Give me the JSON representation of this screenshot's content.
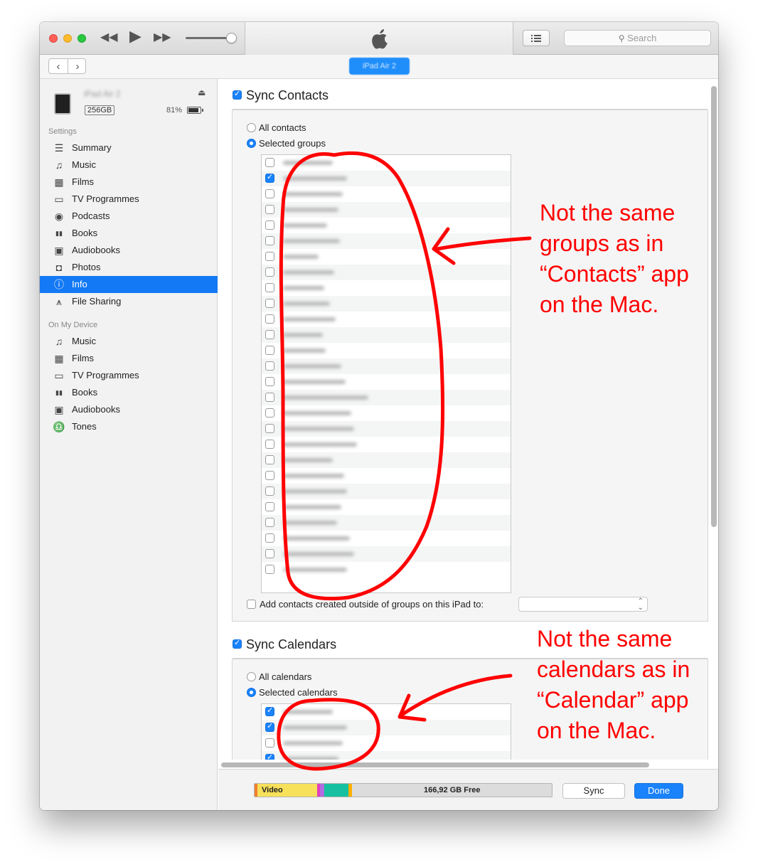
{
  "toolbar": {
    "search_placeholder": "Search",
    "icons": [
      "rewind-icon",
      "play-icon",
      "fast-forward-icon",
      "apple-logo-icon",
      "list-view-icon",
      "search-icon"
    ]
  },
  "navbar": {
    "device_name": "iPad Air 2"
  },
  "device": {
    "name": "iPad Air 2",
    "capacity": "256GB",
    "battery_percent": "81%"
  },
  "sidebar": {
    "settings_header": "Settings",
    "settings": [
      {
        "label": "Summary",
        "icon": "summary-icon"
      },
      {
        "label": "Music",
        "icon": "music-note-icon"
      },
      {
        "label": "Films",
        "icon": "film-icon"
      },
      {
        "label": "TV Programmes",
        "icon": "tv-icon"
      },
      {
        "label": "Podcasts",
        "icon": "podcast-icon"
      },
      {
        "label": "Books",
        "icon": "book-icon"
      },
      {
        "label": "Audiobooks",
        "icon": "audiobook-icon"
      },
      {
        "label": "Photos",
        "icon": "camera-icon"
      },
      {
        "label": "Info",
        "icon": "info-icon",
        "selected": true
      },
      {
        "label": "File Sharing",
        "icon": "app-store-icon"
      }
    ],
    "on_device_header": "On My Device",
    "on_device": [
      {
        "label": "Music",
        "icon": "music-note-icon"
      },
      {
        "label": "Films",
        "icon": "film-icon"
      },
      {
        "label": "TV Programmes",
        "icon": "tv-icon"
      },
      {
        "label": "Books",
        "icon": "book-icon"
      },
      {
        "label": "Audiobooks",
        "icon": "audiobook-icon"
      },
      {
        "label": "Tones",
        "icon": "bell-icon"
      }
    ]
  },
  "contacts": {
    "title": "Sync Contacts",
    "checked": true,
    "option_all": "All contacts",
    "option_selected": "Selected groups",
    "selected_option": "Selected groups",
    "group_checked": [
      false,
      true,
      false,
      false,
      false,
      false,
      false,
      false,
      false,
      false,
      false,
      false,
      false,
      false,
      false,
      false,
      false,
      false,
      false,
      false,
      false,
      false,
      false,
      false,
      false,
      false,
      false
    ],
    "add_outside_label": "Add contacts created outside of groups on this iPad to:"
  },
  "calendars": {
    "title": "Sync Calendars",
    "checked": true,
    "option_all": "All calendars",
    "option_selected": "Selected calendars",
    "selected_option": "Selected calendars",
    "calendar_checked": [
      true,
      true,
      false,
      true
    ]
  },
  "storage": {
    "video_label": "Video",
    "free_label": "166,92 GB Free",
    "colors": {
      "video": "#f7e05a",
      "magenta": "#e040c0",
      "purple": "#b06de0",
      "teal": "#16c0a0",
      "orange": "#ffb000",
      "free": "#dcdcdc"
    }
  },
  "buttons": {
    "sync": "Sync",
    "done": "Done"
  },
  "annotations": {
    "contacts_note": [
      "Not the same",
      "groups as in",
      "“Contacts” app",
      "on the Mac."
    ],
    "calendars_note": [
      "Not the same",
      "calendars as in",
      "“Calendar” app",
      "on the Mac."
    ],
    "ink_color": "#ff0000"
  }
}
